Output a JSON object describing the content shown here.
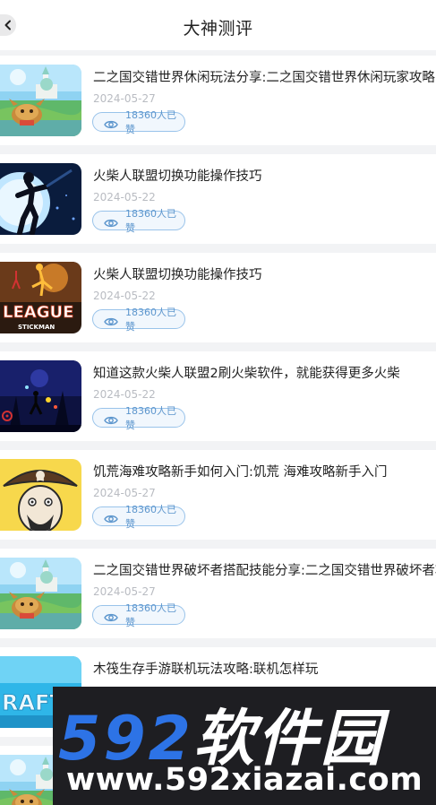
{
  "header": {
    "title": "大神测评",
    "back_icon": "chevron-left-icon"
  },
  "like_icon": "eye-icon",
  "colors": {
    "accent": "#5d96cd",
    "accent_border": "#99c3ea",
    "background": "#f2f3f5",
    "watermark_blue": "#2d73e6"
  },
  "articles": [
    {
      "title": "二之国交错世界休闲玩法分享:二之国交错世界休闲玩家攻略",
      "date": "2024-05-27",
      "likes": "18360人已赞",
      "thumb": "ni-no-kuni"
    },
    {
      "title": "火柴人联盟切换功能操作技巧",
      "date": "2024-05-22",
      "likes": "18360人已赞",
      "thumb": "stickman-moon"
    },
    {
      "title": "火柴人联盟切换功能操作技巧",
      "date": "2024-05-22",
      "likes": "18360人已赞",
      "thumb": "league-of-stickman"
    },
    {
      "title": "知道这款火柴人联盟2刷火柴软件，就能获得更多火柴",
      "date": "2024-05-22",
      "likes": "18360人已赞",
      "thumb": "stickman-battle"
    },
    {
      "title": "饥荒海难攻略新手如何入门:饥荒 海难攻略新手入门",
      "date": "2024-05-27",
      "likes": "18360人已赞",
      "thumb": "pirate"
    },
    {
      "title": "二之国交错世界破坏者搭配技能分享:二之国交错世界破坏者攻略",
      "date": "2024-05-27",
      "likes": "18360人已赞",
      "thumb": "ni-no-kuni"
    },
    {
      "title": "木筏生存手游联机玩法攻略:联机怎样玩",
      "date": "",
      "likes": "",
      "thumb": "raft"
    },
    {
      "title": "",
      "date": "",
      "likes": "",
      "thumb": "ni-no-kuni"
    }
  ],
  "thumb_texts": {
    "league": "LEAGUE",
    "league_sub": "STICKMAN",
    "raft": "RAFT"
  },
  "watermark": {
    "brand_num": "592",
    "brand_cn": "软件园",
    "url": "www.592xiazai.com"
  }
}
